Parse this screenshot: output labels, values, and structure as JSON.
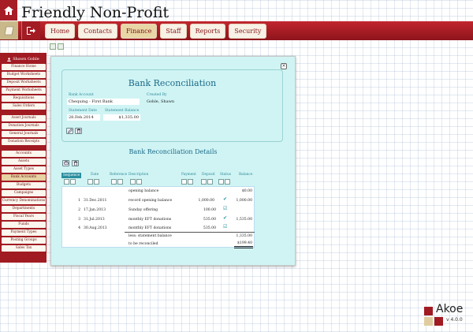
{
  "app": {
    "title": "Friendly Non-Profit"
  },
  "nav": {
    "items": [
      "Home",
      "Contacts",
      "Finance",
      "Staff",
      "Reports",
      "Security"
    ],
    "active": "Finance"
  },
  "sidebar": {
    "user": "Shawn Goble",
    "group1": [
      "Finance Home",
      "Budget Worksheets",
      "Deposit Worksheets",
      "Payment Worksheets",
      "Requisitions",
      "Sales Orders"
    ],
    "group2": [
      "Asset Journals",
      "Donation Journals",
      "General Journals",
      "Donation Receipts"
    ],
    "group3": [
      "Accounts",
      "Assets",
      "Asset Types",
      "Bank Accounts",
      "Budgets",
      "Campaigns",
      "Currency Denominations",
      "Departments",
      "Fiscal Years",
      "Funds",
      "Payment Types",
      "Posting Groups",
      "Sales Tax"
    ],
    "active": "Bank Accounts"
  },
  "form": {
    "title": "Bank Reconciliation",
    "bank_account_label": "Bank Account",
    "bank_account": "Chequing - First Bank",
    "created_by_label": "Created By",
    "created_by": "Goble, Shawn",
    "statement_date_label": "Statement Date",
    "statement_date": "28.Feb.2014",
    "statement_balance_label": "Statement Balance",
    "statement_balance": "$1,335.00"
  },
  "details": {
    "title": "Bank Reconciliation Details",
    "headers": {
      "sequence": "Sequence",
      "date": "Date",
      "reference": "Reference",
      "description": "Description",
      "payment": "Payment",
      "deposit": "Deposit",
      "status": "Status",
      "balance": "Balance"
    },
    "rows": [
      {
        "seq": "",
        "date": "",
        "desc": "opening balance",
        "payment": "",
        "deposit": "",
        "status": "",
        "balance": "$0.00"
      },
      {
        "seq": "1",
        "date": "31.Dec.2011",
        "desc": "record opening balance",
        "payment": "1,000.00",
        "deposit": "",
        "status": "check",
        "balance": "1,000.00"
      },
      {
        "seq": "2",
        "date": "17.Jan.2013",
        "desc": "Sunday offering",
        "payment": "",
        "deposit": "100.00",
        "status": "check-outline",
        "balance": ""
      },
      {
        "seq": "3",
        "date": "31.Jul.2013",
        "desc": "monthly EFT donations",
        "payment": "",
        "deposit": "535.00",
        "status": "check",
        "balance": "1,535.00"
      },
      {
        "seq": "4",
        "date": "30.Aug.2013",
        "desc": "monthly EFT donations",
        "payment": "",
        "deposit": "535.00",
        "status": "check-outline",
        "balance": ""
      }
    ],
    "less_label": "less: statement balance",
    "less_value": "1,335.00",
    "reconcile_label": "to be reconciled",
    "reconcile_value": "$199.40"
  },
  "brand": {
    "name": "Akoe",
    "version": "v 4.0.0"
  },
  "colors": {
    "brand_red": "#a11b22",
    "panel_cyan": "#d0f4f4",
    "accent_teal": "#1b6a88"
  }
}
